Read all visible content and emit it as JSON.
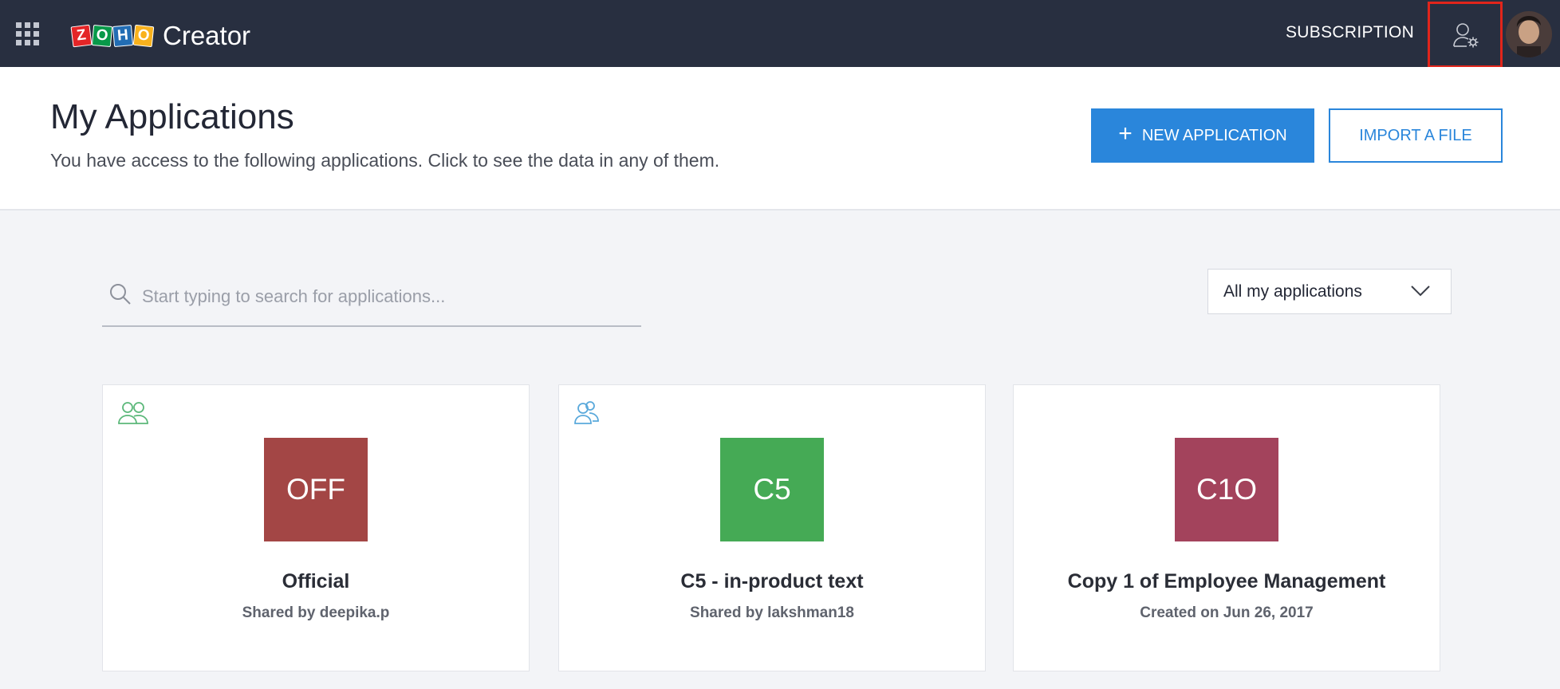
{
  "topbar": {
    "logo_letters": [
      "Z",
      "O",
      "H",
      "O"
    ],
    "product_name": "Creator",
    "subscription_label": "SUBSCRIPTION",
    "user_settings_icon": "user-gear-icon"
  },
  "header": {
    "title": "My Applications",
    "subtitle": "You have access to the following applications. Click to see the data in any of them.",
    "new_application_label": "NEW APPLICATION",
    "import_file_label": "IMPORT A FILE"
  },
  "search": {
    "placeholder": "Start typing to search for applications..."
  },
  "filter": {
    "selected": "All my applications"
  },
  "apps": [
    {
      "abbr": "OFF",
      "name": "Official",
      "meta": "Shared by deepika.p",
      "color": "#a34645",
      "share_icon_color": "#5cb87a"
    },
    {
      "abbr": "C5",
      "name": "C5 - in-product text",
      "meta": "Shared by lakshman18",
      "color": "#45aa55",
      "share_icon_color": "#5aa9db"
    },
    {
      "abbr": "C1O",
      "name": "Copy 1 of Employee Management",
      "meta": "Created on Jun 26, 2017",
      "color": "#a3435c"
    }
  ],
  "colors": {
    "topbar_bg": "#282f40",
    "accent": "#2a86db",
    "highlight_box": "#e1251b"
  }
}
